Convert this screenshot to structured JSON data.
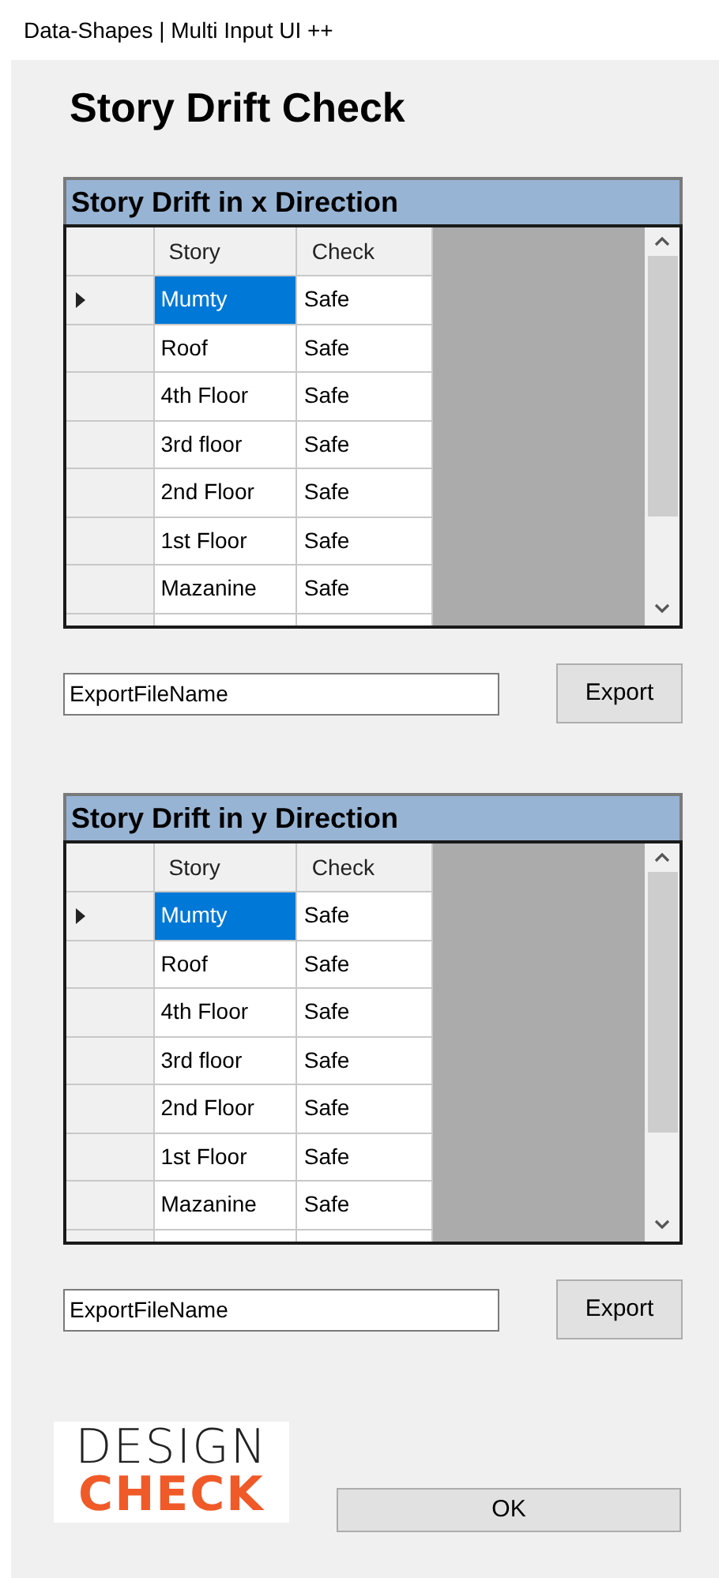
{
  "window": {
    "title": "Data-Shapes | Multi Input UI ++"
  },
  "heading": "Story Drift Check",
  "sections": [
    {
      "title": "Story Drift in x Direction",
      "columns": [
        "Story",
        "Check"
      ],
      "rows": [
        {
          "story": "Mumty",
          "check": "Safe",
          "selected": true
        },
        {
          "story": "Roof",
          "check": "Safe",
          "selected": false
        },
        {
          "story": "4th Floor",
          "check": "Safe",
          "selected": false
        },
        {
          "story": "3rd floor",
          "check": "Safe",
          "selected": false
        },
        {
          "story": "2nd Floor",
          "check": "Safe",
          "selected": false
        },
        {
          "story": "1st Floor",
          "check": "Safe",
          "selected": false
        },
        {
          "story": "Mazanine",
          "check": "Safe",
          "selected": false
        }
      ],
      "export_field": {
        "value": "ExportFileName"
      },
      "export_button": "Export"
    },
    {
      "title": "Story Drift in y Direction",
      "columns": [
        "Story",
        "Check"
      ],
      "rows": [
        {
          "story": "Mumty",
          "check": "Safe",
          "selected": true
        },
        {
          "story": "Roof",
          "check": "Safe",
          "selected": false
        },
        {
          "story": "4th Floor",
          "check": "Safe",
          "selected": false
        },
        {
          "story": "3rd floor",
          "check": "Safe",
          "selected": false
        },
        {
          "story": "2nd Floor",
          "check": "Safe",
          "selected": false
        },
        {
          "story": "1st Floor",
          "check": "Safe",
          "selected": false
        },
        {
          "story": "Mazanine",
          "check": "Safe",
          "selected": false
        }
      ],
      "export_field": {
        "value": "ExportFileName"
      },
      "export_button": "Export"
    }
  ],
  "logo": {
    "line_1": "DESIGN",
    "line_2": "CHECK"
  },
  "ok_button": "OK"
}
